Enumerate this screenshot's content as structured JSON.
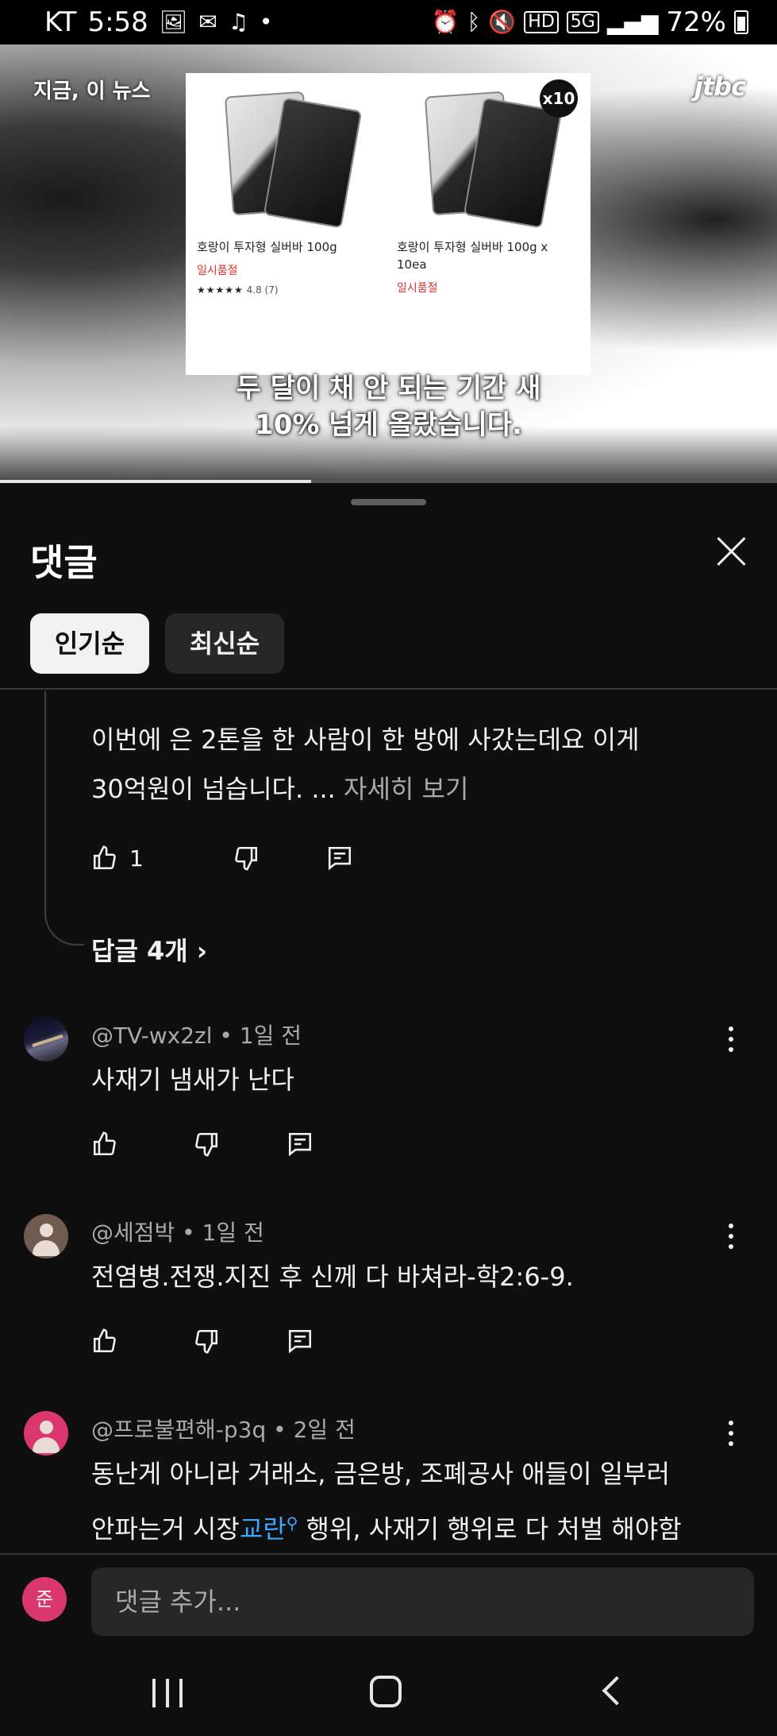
{
  "status_bar": {
    "carrier": "KT",
    "time": "5:58",
    "network": "5G",
    "hd": "HD",
    "battery": "72%",
    "dot": "•",
    "icons": [
      "image-icon",
      "mail-icon",
      "music-icon",
      "alarm-icon",
      "bluetooth-icon",
      "mute-icon",
      "signal-icon",
      "battery-icon"
    ]
  },
  "video": {
    "brand_left": "지금, 이 뉴스",
    "brand_right": "jtbc",
    "products": [
      {
        "name": "호랑이 투자형 실버바 100g",
        "status": "일시품절",
        "rating_stars": "★★★★★",
        "rating": "4.8",
        "rating_count": "(7)"
      },
      {
        "name": "호랑이 투자형 실버바 100g x 10ea",
        "status": "일시품절",
        "badge": "x10"
      }
    ],
    "subtitle_line1": "두 달이 채 안 되는 기간 새",
    "subtitle_line2": "10% 넘게 올랐습니다.",
    "progress_fraction": 0.4
  },
  "comments_panel": {
    "title": "댓글",
    "sort_popular": "인기순",
    "sort_newest": "최신순",
    "pinned_comment": {
      "text_line1": "이번에 은 2톤을 한 사람이 한 방에 사갔는데요 이게",
      "text_line2": "30억원이 넘습니다. ... ",
      "more": "자세히 보기",
      "likes": "1",
      "replies": "답글 4개 ›"
    },
    "comments": [
      {
        "author": "@TV-wx2zl",
        "time": "1일 전",
        "text": "사재기 냄새가 난다"
      },
      {
        "author": "@세점박",
        "time": "1일 전",
        "text": "전염병.전쟁.지진 후 신께 다 바쳐라-학2:6-9."
      },
      {
        "author": "@프로불편해-p3q",
        "time": "2일 전",
        "text_line1": "동난게 아니라 거래소, 금은방, 조폐공사 애들이 일부러",
        "text_line2_before": "안파는거 시장",
        "text_line2_link": "교란",
        "text_line2_after": " 행위, 사재기 행위로 다 처벌 해야함"
      }
    ],
    "meta_separator": " • ",
    "add_comment_avatar": "준",
    "add_comment_placeholder": "댓글 추가..."
  },
  "colors": {
    "background": "#0f0f0f",
    "chip_active": "#f1f1f1",
    "chip_inactive": "#272727",
    "link": "#3ea6ff",
    "avatar_pink": "#d9376e"
  }
}
